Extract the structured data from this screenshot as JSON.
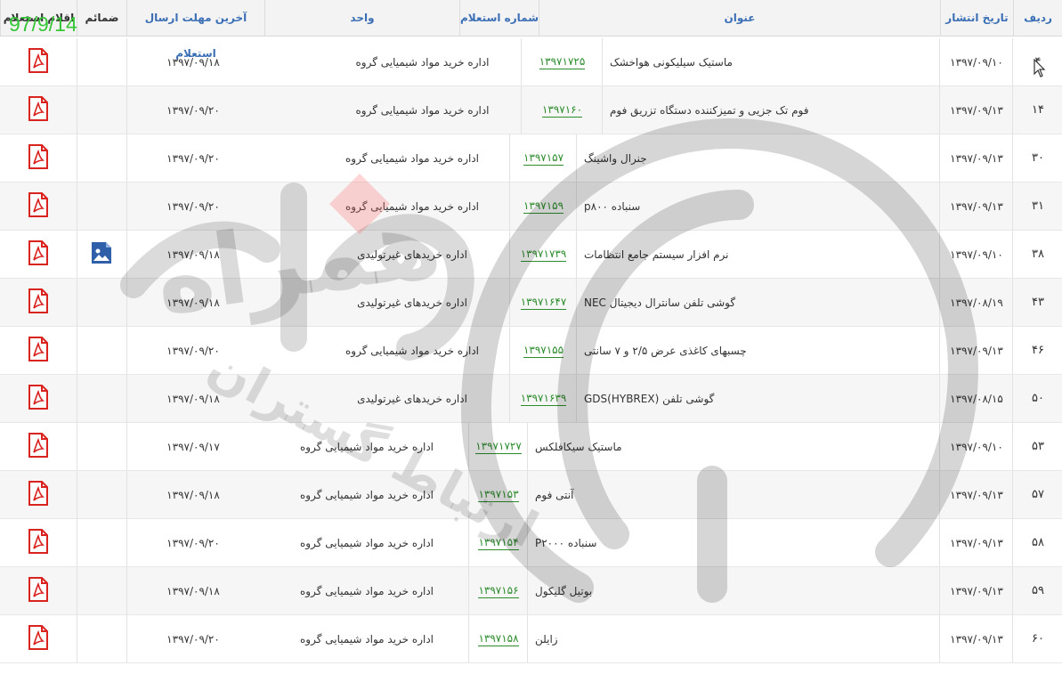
{
  "corner_date": "97/9/14",
  "header": {
    "radif": "ردیف",
    "publish_date": "تاریخ انتشار",
    "title": "عنوان",
    "inquiry_number": "شماره استعلام",
    "unit": "واحد",
    "deadline": "آخرین مهلت ارسال استعلام",
    "attachments": "ضمائم",
    "inquiry_items": "اقلام استعلام"
  },
  "rows": [
    {
      "radif": "۴",
      "date": "۱۳۹۷/۰۹/۱۰",
      "title": "ماستیک سیلیکونی هواخشک",
      "num": "۱۳۹۷۱۷۲۵",
      "unit": "اداره خرید مواد شیمیایی گروه",
      "deadline": "۱۳۹۷/۰۹/۱۸",
      "attachment": false
    },
    {
      "radif": "۱۴",
      "date": "۱۳۹۷/۰۹/۱۳",
      "title": "فوم تک جزیی و تمیزکننده دستگاه تزریق فوم",
      "num": "۱۳۹۷۱۶۰",
      "unit": "اداره خرید مواد شیمیایی گروه",
      "deadline": "۱۳۹۷/۰۹/۲۰",
      "attachment": false
    },
    {
      "radif": "۳۰",
      "date": "۱۳۹۷/۰۹/۱۳",
      "title": "جنرال واشینگ",
      "num": "۱۳۹۷۱۵۷",
      "unit": "اداره خرید مواد شیمیایی گروه",
      "deadline": "۱۳۹۷/۰۹/۲۰",
      "attachment": false
    },
    {
      "radif": "۳۱",
      "date": "۱۳۹۷/۰۹/۱۳",
      "title": "سنباده p۸۰۰",
      "num": "۱۳۹۷۱۵۹",
      "unit": "اداره خرید مواد شیمیایی گروه",
      "deadline": "۱۳۹۷/۰۹/۲۰",
      "attachment": false
    },
    {
      "radif": "۳۸",
      "date": "۱۳۹۷/۰۹/۱۰",
      "title": "نرم افزار سیستم جامع انتظامات",
      "num": "۱۳۹۷۱۷۳۹",
      "unit": "اداره خریدهای غیرتولیدی",
      "deadline": "۱۳۹۷/۰۹/۱۸",
      "attachment": true
    },
    {
      "radif": "۴۳",
      "date": "۱۳۹۷/۰۸/۱۹",
      "title": "گوشی تلفن سانترال دیجیتال NEC",
      "num": "۱۳۹۷۱۶۴۷",
      "unit": "اداره خریدهای غیرتولیدی",
      "deadline": "۱۳۹۷/۰۹/۱۸",
      "attachment": false
    },
    {
      "radif": "۴۶",
      "date": "۱۳۹۷/۰۹/۱۳",
      "title": "چسبهای کاغذی عرض ۲/۵ و ۷ سانتی",
      "num": "۱۳۹۷۱۵۵",
      "unit": "اداره خرید مواد شیمیایی گروه",
      "deadline": "۱۳۹۷/۰۹/۲۰",
      "attachment": false
    },
    {
      "radif": "۵۰",
      "date": "۱۳۹۷/۰۸/۱۵",
      "title": "گوشی تلفن (GDS(HYBREX",
      "num": "۱۳۹۷۱۶۳۹",
      "unit": "اداره خریدهای غیرتولیدی",
      "deadline": "۱۳۹۷/۰۹/۱۸",
      "attachment": false
    },
    {
      "radif": "۵۳",
      "date": "۱۳۹۷/۰۹/۱۰",
      "title": "ماستیک سیکافلکس",
      "num": "۱۳۹۷۱۷۲۷",
      "unit": "اداره خرید مواد شیمیایی گروه",
      "deadline": "۱۳۹۷/۰۹/۱۷",
      "attachment": false
    },
    {
      "radif": "۵۷",
      "date": "۱۳۹۷/۰۹/۱۳",
      "title": "آنتی فوم",
      "num": "۱۳۹۷۱۵۳",
      "unit": "اداره خرید مواد شیمیایی گروه",
      "deadline": "۱۳۹۷/۰۹/۱۸",
      "attachment": false
    },
    {
      "radif": "۵۸",
      "date": "۱۳۹۷/۰۹/۱۳",
      "title": "سنباده P۲۰۰۰",
      "num": "۱۳۹۷۱۵۴",
      "unit": "اداره خرید مواد شیمیایی گروه",
      "deadline": "۱۳۹۷/۰۹/۲۰",
      "attachment": false
    },
    {
      "radif": "۵۹",
      "date": "۱۳۹۷/۰۹/۱۳",
      "title": "بوتیل گلیکول",
      "num": "۱۳۹۷۱۵۶",
      "unit": "اداره خرید مواد شیمیایی گروه",
      "deadline": "۱۳۹۷/۰۹/۱۸",
      "attachment": false
    },
    {
      "radif": "۶۰",
      "date": "۱۳۹۷/۰۹/۱۳",
      "title": "زایلن",
      "num": "۱۳۹۷۱۵۸",
      "unit": "اداره خرید مواد شیمیایی گروه",
      "deadline": "۱۳۹۷/۰۹/۲۰",
      "attachment": false
    }
  ],
  "colors": {
    "header_text": "#3b6fb5",
    "inquiry_number": "#2c8c2c",
    "pdf_icon": "#d9231f",
    "corner_date": "#37c637"
  },
  "icons": {
    "file_column": "pdf-file-icon",
    "attachment_column": "image-file-icon"
  },
  "watermark_text": [
    "همراه",
    "ارتباط گستران"
  ]
}
